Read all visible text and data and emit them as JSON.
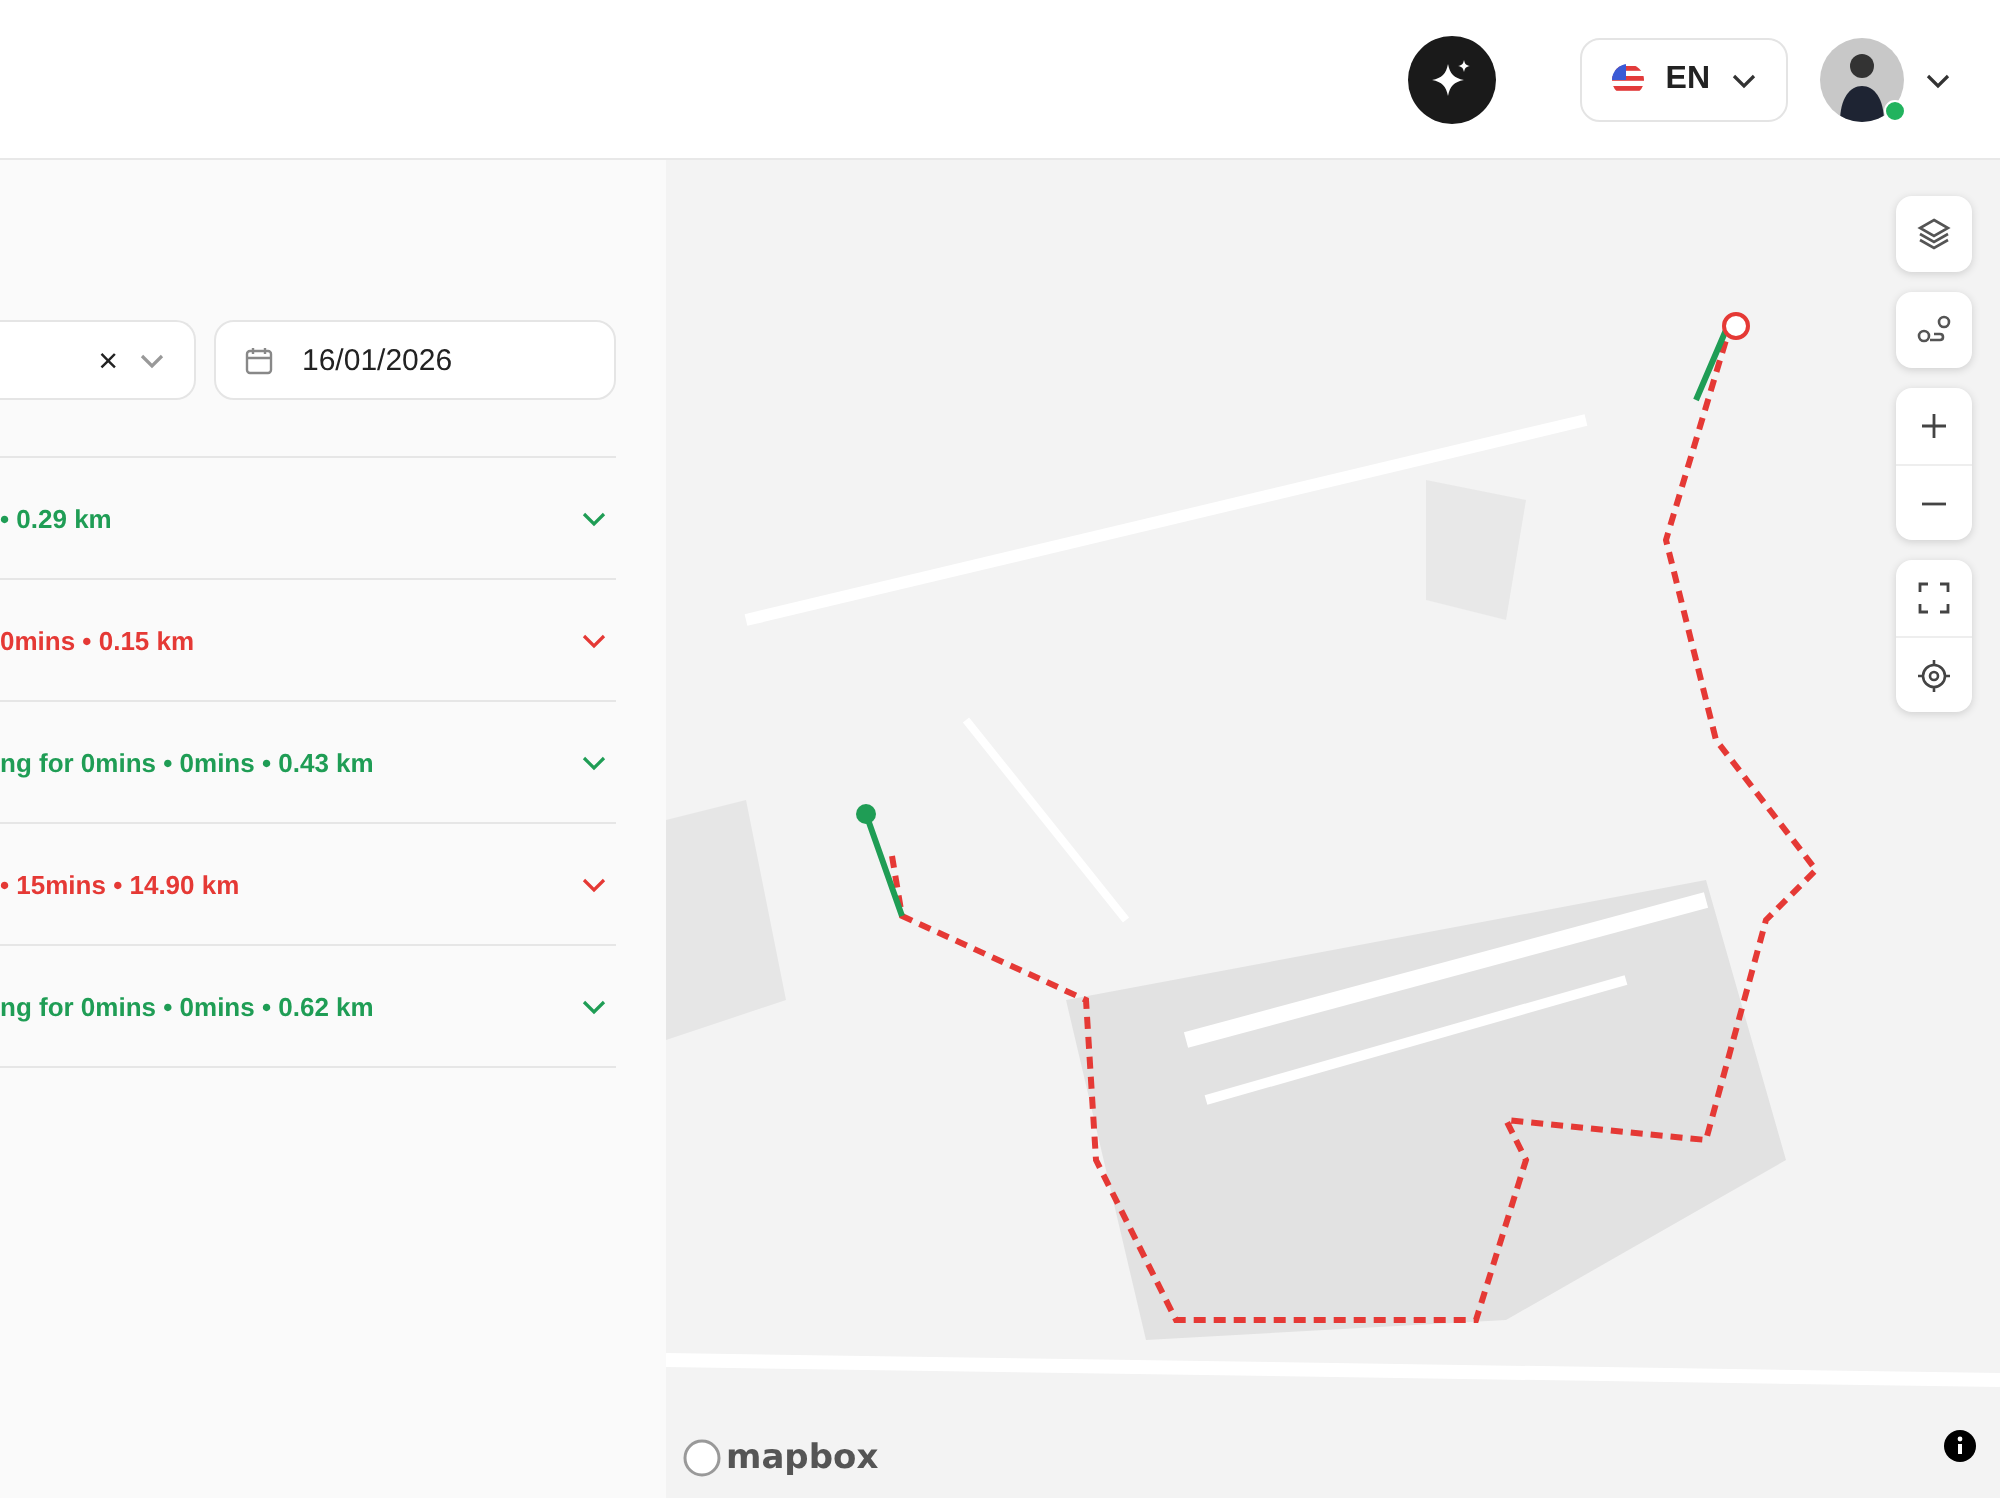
{
  "header": {
    "language": {
      "code": "EN"
    },
    "user": {
      "online": true
    }
  },
  "filters": {
    "clear": "×",
    "date": "16/01/2026"
  },
  "trips": [
    {
      "summary": "• 0.29 km",
      "color": "#1f9d55",
      "expanded": false
    },
    {
      "summary": "0mins • 0.15 km",
      "color": "#e53935",
      "expanded": false
    },
    {
      "summary": "ng for 0mins • 0mins • 0.43 km",
      "color": "#1f9d55",
      "expanded": false
    },
    {
      "summary": "• 15mins • 14.90 km",
      "color": "#e53935",
      "expanded": false
    },
    {
      "summary": "ng for 0mins • 0mins • 0.62 km",
      "color": "#1f9d55",
      "expanded": false
    }
  ],
  "map": {
    "kind": "picture",
    "attribution": "mapbox"
  }
}
